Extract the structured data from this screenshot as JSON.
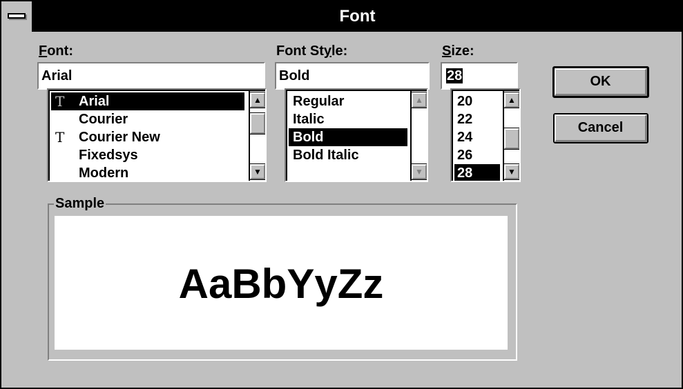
{
  "window": {
    "title": "Font"
  },
  "font": {
    "label_prefix": "F",
    "label_rest": "ont:",
    "value": "Arial",
    "items": [
      {
        "label": "Arial",
        "truetype": true,
        "selected": true
      },
      {
        "label": "Courier",
        "truetype": false,
        "selected": false
      },
      {
        "label": "Courier New",
        "truetype": true,
        "selected": false
      },
      {
        "label": "Fixedsys",
        "truetype": false,
        "selected": false
      },
      {
        "label": "Modern",
        "truetype": false,
        "selected": false
      }
    ]
  },
  "style": {
    "label_a": "Font St",
    "label_u": "y",
    "label_b": "le:",
    "value": "Bold",
    "items": [
      {
        "label": "Regular",
        "selected": false
      },
      {
        "label": "Italic",
        "selected": false
      },
      {
        "label": "Bold",
        "selected": true
      },
      {
        "label": "Bold Italic",
        "selected": false
      }
    ]
  },
  "size": {
    "label_prefix": "S",
    "label_rest": "ize:",
    "value": "28",
    "items": [
      {
        "label": "20",
        "selected": false
      },
      {
        "label": "22",
        "selected": false
      },
      {
        "label": "24",
        "selected": false
      },
      {
        "label": "26",
        "selected": false
      },
      {
        "label": "28",
        "selected": true
      }
    ]
  },
  "buttons": {
    "ok": "OK",
    "cancel": "Cancel"
  },
  "sample": {
    "legend": "Sample",
    "text": "AaBbYyZz"
  },
  "icons": {
    "sysmenu": "system-menu-icon",
    "up": "▲",
    "down": "▼",
    "tt": "Ŧ"
  }
}
